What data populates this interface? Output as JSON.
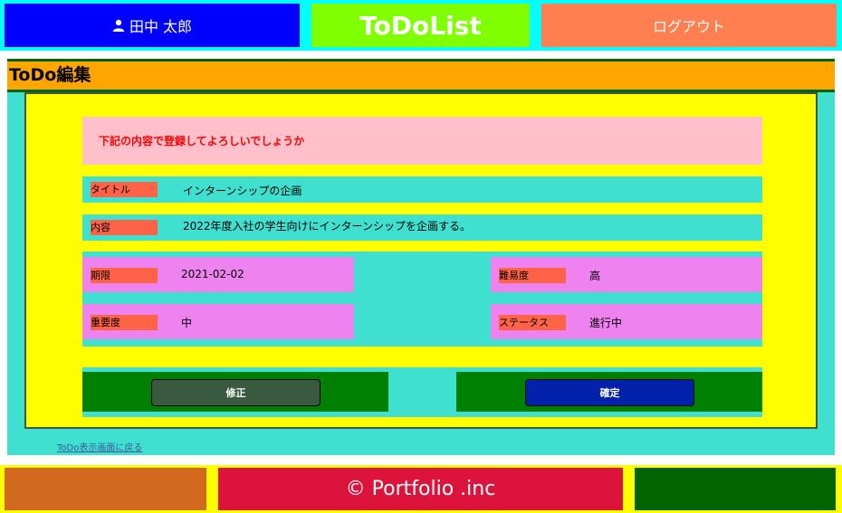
{
  "header": {
    "user_name": "田中 太郎",
    "brand": "ToDoList",
    "logout": "ログアウト"
  },
  "page": {
    "title": "ToDo編集",
    "confirm_message": "下記の内容で登録してよろしいでしょうか",
    "fields": {
      "title": {
        "label": "タイトル",
        "value": "インターンシップの企画"
      },
      "content": {
        "label": "内容",
        "value": "2022年度入社の学生向けにインターンシップを企画する。"
      },
      "deadline": {
        "label": "期限",
        "value": "2021-02-02"
      },
      "difficulty": {
        "label": "難易度",
        "value": "高"
      },
      "importance": {
        "label": "重要度",
        "value": "中"
      },
      "status": {
        "label": "ステータス",
        "value": "進行中"
      }
    },
    "buttons": {
      "edit": "修正",
      "confirm": "確定"
    },
    "back_link": "ToDo表示画面に戻る"
  },
  "footer": {
    "copyright": "© Portfolio .inc"
  },
  "colors": {
    "header_bg": "#00ffff",
    "user_bg": "#0000ff",
    "brand_bg": "#7fff00",
    "logout_bg": "#ff7f50",
    "title_bg": "#ffa500",
    "panel_bg": "#ffff00",
    "confirm_bg": "#ffc0cb",
    "label_bg": "#ff6347",
    "cell_bg": "#ee82ee",
    "button_box_bg": "#008000",
    "edit_button_bg": "#3a5a40",
    "confirm_button_bg": "#0022aa",
    "footer_left": "#d2691e",
    "footer_center": "#dc143c",
    "footer_right": "#006400"
  }
}
